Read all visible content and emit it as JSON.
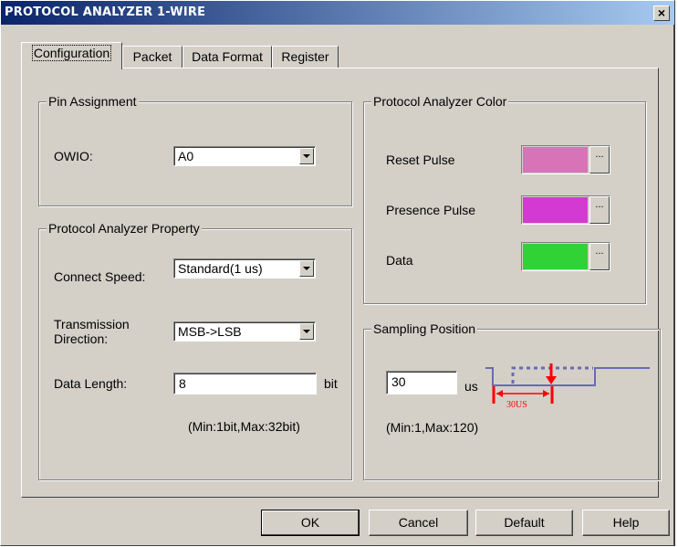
{
  "window": {
    "title": "PROTOCOL ANALYZER 1-WIRE",
    "close_glyph": "×"
  },
  "tabs": [
    {
      "label": "Configuration",
      "active": true
    },
    {
      "label": "Packet",
      "active": false
    },
    {
      "label": "Data Format",
      "active": false
    },
    {
      "label": "Register",
      "active": false
    }
  ],
  "pin_assignment": {
    "title": "Pin Assignment",
    "owio_label": "OWIO:",
    "owio_value": "A0"
  },
  "property": {
    "title": "Protocol Analyzer Property",
    "speed_label": "Connect Speed:",
    "speed_value": "Standard(1 us)",
    "direction_label_line1": "Transmission",
    "direction_label_line2": "Direction:",
    "direction_value": "MSB->LSB",
    "length_label": "Data Length:",
    "length_value": "8",
    "length_unit": "bit",
    "length_range": "(Min:1bit,Max:32bit)"
  },
  "color": {
    "title": "Protocol Analyzer Color",
    "items": [
      {
        "label": "Reset Pulse",
        "color": "#d873b8"
      },
      {
        "label": "Presence Pulse",
        "color": "#d23ad2"
      },
      {
        "label": "Data",
        "color": "#31d236"
      }
    ],
    "more_glyph": "..."
  },
  "sampling": {
    "title": "Sampling Position",
    "value": "30",
    "unit": "us",
    "range": "(Min:1,Max:120)",
    "diagram_label": "30US"
  },
  "buttons": {
    "ok": "OK",
    "cancel": "Cancel",
    "default": "Default",
    "help": "Help"
  },
  "colors": {
    "title_start": "#0a246a",
    "title_end": "#a6caf0",
    "face": "#d4d0c8",
    "wave": "#6a6ab4",
    "marker": "#ff0000"
  }
}
